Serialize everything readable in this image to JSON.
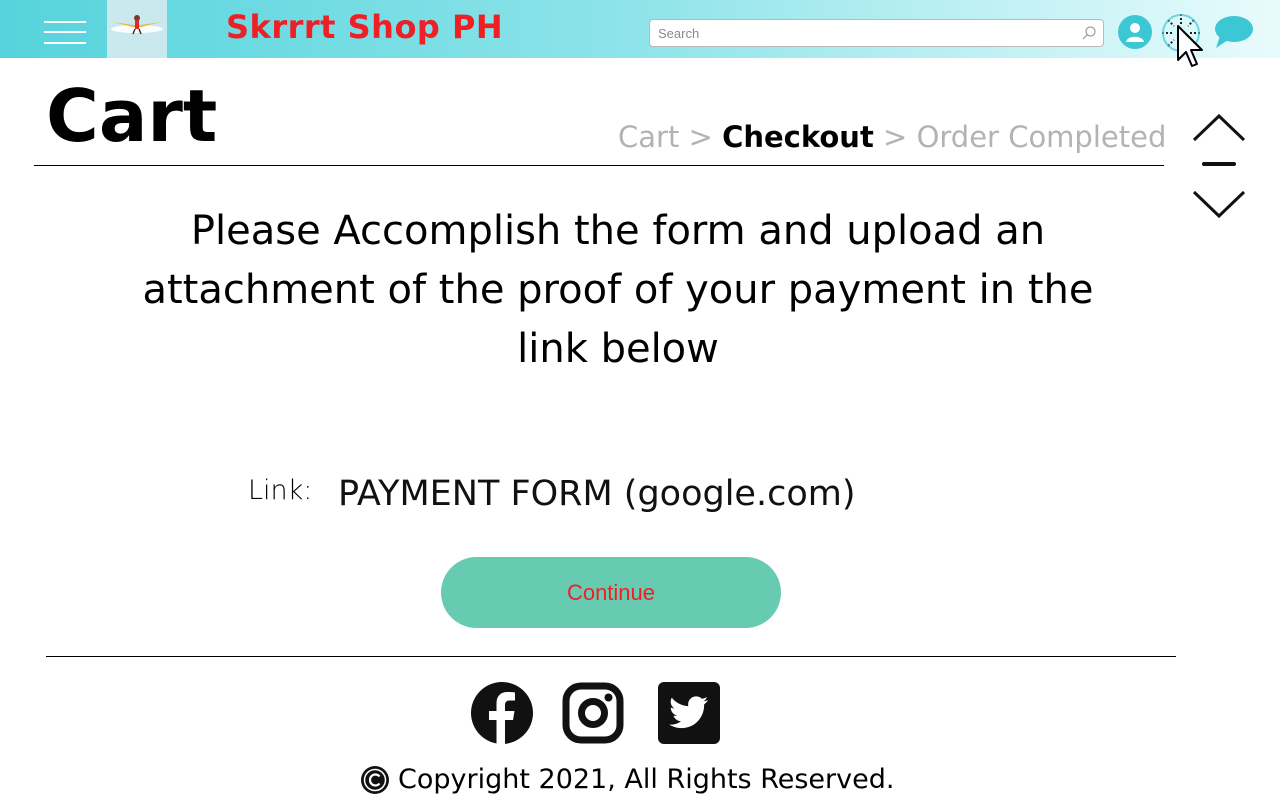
{
  "header": {
    "brand": "Skrrrt Shop PH",
    "search": {
      "placeholder": "Search",
      "value": ""
    },
    "icons": [
      "menu-icon",
      "logo",
      "search-icon",
      "user-icon",
      "loading-icon",
      "cursor-icon",
      "chat-icon"
    ]
  },
  "page": {
    "title": "Cart",
    "breadcrumb": {
      "step1": "Cart",
      "sep": ">",
      "step2": "Checkout",
      "step3": "Order Completed"
    },
    "message": "Please Accomplish the form and upload an attachment of the proof of your payment in the link below",
    "link_label": "Link:",
    "link_text": "PAYMENT FORM (google.com)",
    "continue_label": "Continue"
  },
  "footer": {
    "copyright": "Copyright 2021, All Rights Reserved.",
    "social": [
      "facebook-icon",
      "instagram-icon",
      "twitter-icon"
    ]
  },
  "colors": {
    "brand_red": "#ee1f25",
    "header_teal": "#56d3dc",
    "button_green": "#67cbb1"
  }
}
